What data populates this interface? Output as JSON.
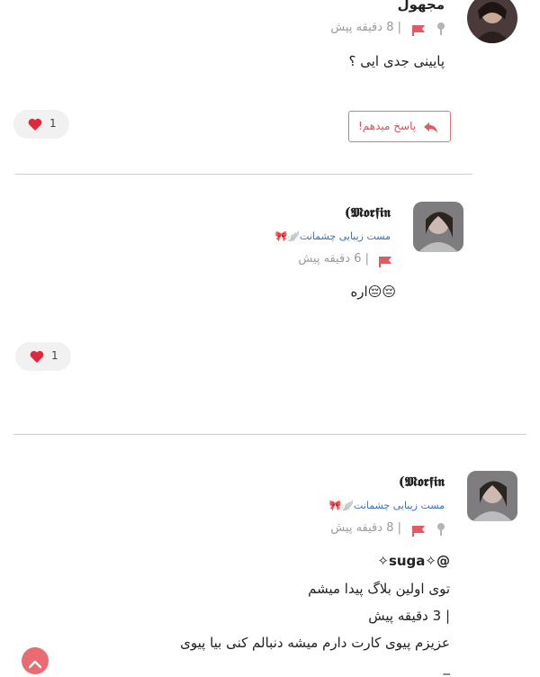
{
  "comments": [
    {
      "author": "مجهول",
      "time": "| 8 دقیقه پیش",
      "text": "پایینی جدی ایی ؟",
      "reply_label": "پاسخ میدهم!",
      "likes": "1"
    },
    {
      "author": "(𝕸𝖔𝖗𝖋𝖎𝖓",
      "subtitle": "مست زیبایی چشمانت🪽🎀",
      "time": "| 6 دقیقه پیش",
      "text": "😔😔اره",
      "likes": "1"
    },
    {
      "author": "(𝕸𝖔𝖗𝖋𝖎𝖓",
      "subtitle": "مست زیبایی چشمانت🪽🎀",
      "time": "| 8 دقیقه پیش",
      "lines": [
        "@✧𝘀𝘂𝗴𝗮✧",
        "توی اولین بلاگ پیدا میشم",
        "| 3 دقیقه پیش",
        "عزیزم پیوی کارت دارم میشه دنبالم کنی بیا پیوی",
        "_"
      ]
    }
  ],
  "colors": {
    "accent": "#e05a62",
    "muted": "#9a9a9a",
    "link": "#3d6fb3"
  }
}
